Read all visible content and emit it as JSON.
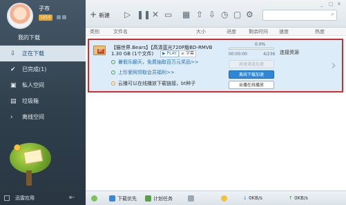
{
  "user": {
    "name": "子市",
    "level": "LV14"
  },
  "sidebar": {
    "title": "我的下载",
    "items": [
      {
        "label": "正在下载",
        "icon": "download-arrow-icon"
      },
      {
        "label": "已完成(1)",
        "icon": "check-circle-icon"
      },
      {
        "label": "私人空间",
        "icon": "lock-icon"
      },
      {
        "label": "垃圾箱",
        "icon": "trash-icon"
      },
      {
        "label": "离线空间",
        "icon": "cloud-icon"
      }
    ],
    "bottom": {
      "label": "迅雷应用"
    }
  },
  "toolbar": {
    "new_label": "新建"
  },
  "columns": {
    "type": "类别",
    "name": "文件名",
    "size": "大小",
    "progress": "进度",
    "remaining": "剩余时间",
    "speed": "速度",
    "heat": "热度"
  },
  "task": {
    "name": "【猫世界.Bears】【高清蓝光720P版BD-RMVB",
    "size": "1.30 GB (1个文件)",
    "play": "PLAY",
    "subtitle": "字幕",
    "progress_text": "0.0%",
    "progress": 0,
    "eta": "00:00:00",
    "pieces": "4/236",
    "status": "连接资源",
    "promos": [
      "暑假乐翻天，免费抽取百万元奖品>>",
      "上珍爱网领取会员福利>>",
      "云播可以在线播放下载链接，bt种子"
    ],
    "actions": {
      "accelerate": "高速通道加速",
      "offline": "离线下载加速",
      "cloud_play": "云播在线播放"
    }
  },
  "statusbar": {
    "priority": "下载优先",
    "schedule": "计划任务",
    "down_speed": "0KB/s",
    "up_speed": "0KB/s"
  }
}
